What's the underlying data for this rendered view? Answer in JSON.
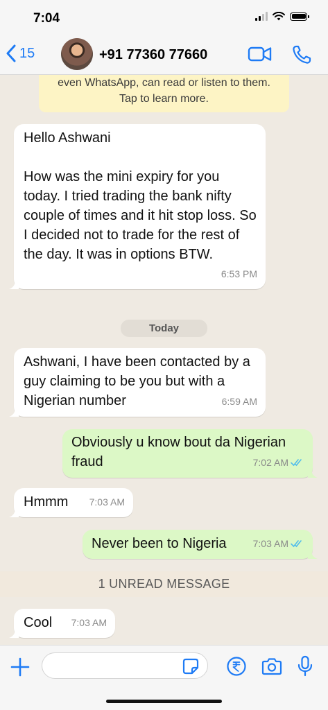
{
  "status_bar": {
    "time": "7:04"
  },
  "header": {
    "back_count": "15",
    "contact_name": "+91 77360 77660"
  },
  "encryption_notice": {
    "line1": "even WhatsApp, can read or listen to them.",
    "line2": "Tap to learn more."
  },
  "messages": [
    {
      "direction": "incoming",
      "text": "Hello Ashwani\n\nHow was the mini expiry for you today. I tried trading the bank nifty couple of times and it hit stop loss. So I decided not to trade for the rest of the day. It was in options BTW.",
      "time": "6:53 PM"
    },
    {
      "direction": "incoming",
      "text": "Ashwani, I have been contacted by a guy claiming to be you but with a Nigerian number",
      "time": "6:59 AM"
    },
    {
      "direction": "outgoing",
      "text": "Obviously u know bout da Nigerian fraud",
      "time": "7:02 AM",
      "status": "read"
    },
    {
      "direction": "incoming",
      "text": "Hmmm",
      "time": "7:03 AM"
    },
    {
      "direction": "outgoing",
      "text": "Never been to Nigeria",
      "time": "7:03 AM",
      "status": "read"
    },
    {
      "direction": "incoming",
      "text": "Cool",
      "time": "7:03 AM"
    }
  ],
  "date_divider": "Today",
  "unread_banner": "1 UNREAD MESSAGE",
  "input_bar": {
    "placeholder": "",
    "value": ""
  },
  "colors": {
    "accent_blue": "#1e7bf5",
    "outgoing_bubble": "#dcf8c6",
    "incoming_bubble": "#ffffff",
    "read_ticks": "#53bdeb",
    "chat_background": "#efeae2",
    "notice_background": "#fdf4c5"
  },
  "icons": {
    "back": "chevron-left-icon",
    "video": "video-camera-icon",
    "call": "phone-icon",
    "plus": "plus-icon",
    "sticker": "sticker-icon",
    "payment": "rupee-icon",
    "camera": "camera-icon",
    "mic": "microphone-icon",
    "ticks": "double-check-icon"
  }
}
